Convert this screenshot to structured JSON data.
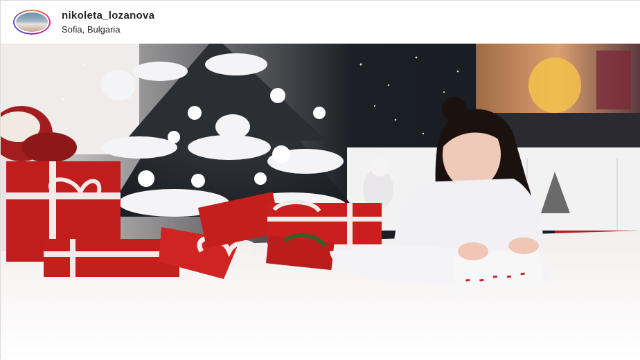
{
  "post": {
    "username": "nikoleta_lozanova",
    "location": "Sofia, Bulgaria"
  },
  "icons": {
    "avatar": "profile-avatar"
  },
  "colors": {
    "gift_red": "#c8201e",
    "carpet": "#f4f1f0",
    "text": "#262626"
  }
}
